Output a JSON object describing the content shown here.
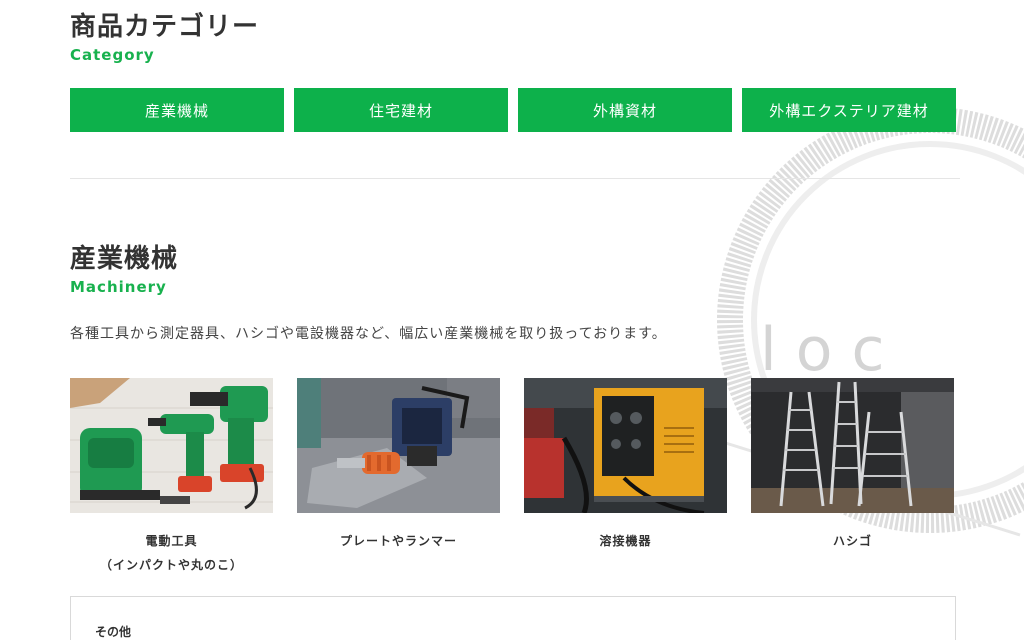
{
  "category_section": {
    "title": "商品カテゴリー",
    "subtitle": "Category",
    "buttons": [
      {
        "label": "産業機械"
      },
      {
        "label": "住宅建材"
      },
      {
        "label": "外構資材"
      },
      {
        "label": "外構エクステリア建材"
      }
    ]
  },
  "machinery_section": {
    "title": "産業機械",
    "subtitle": "Machinery",
    "description": "各種工具から測定器具、ハシゴや電設機器など、幅広い産業機械を取り扱っております。",
    "products": [
      {
        "line1": "電動工具",
        "line2": "（インパクトや丸のこ）"
      },
      {
        "line1": "プレートやランマー",
        "line2": ""
      },
      {
        "line1": "溶接機器",
        "line2": ""
      },
      {
        "line1": "ハシゴ",
        "line2": ""
      }
    ],
    "other": {
      "title": "その他"
    }
  },
  "colors": {
    "accent": "#0db14b",
    "subtitle": "#18b14e"
  },
  "icons": {
    "watermark": "logo-watermark"
  }
}
